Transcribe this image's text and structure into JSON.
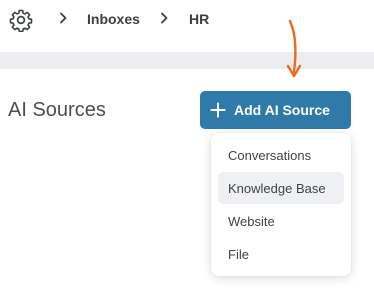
{
  "breadcrumb": {
    "settings_icon": "gear-icon",
    "items": [
      "Inboxes",
      "HR"
    ]
  },
  "main": {
    "title": "AI Sources",
    "add_button": {
      "label": "Add AI Source",
      "icon": "plus-icon"
    }
  },
  "dropdown": {
    "items": [
      {
        "label": "Conversations",
        "highlighted": false
      },
      {
        "label": "Knowledge Base",
        "highlighted": true
      },
      {
        "label": "Website",
        "highlighted": false
      },
      {
        "label": "File",
        "highlighted": false
      }
    ]
  },
  "colors": {
    "accent": "#2f7aa8",
    "annotation_arrow": "#f0671f",
    "header_strip": "#ebedf1",
    "menu_highlight": "#eef0f3"
  }
}
